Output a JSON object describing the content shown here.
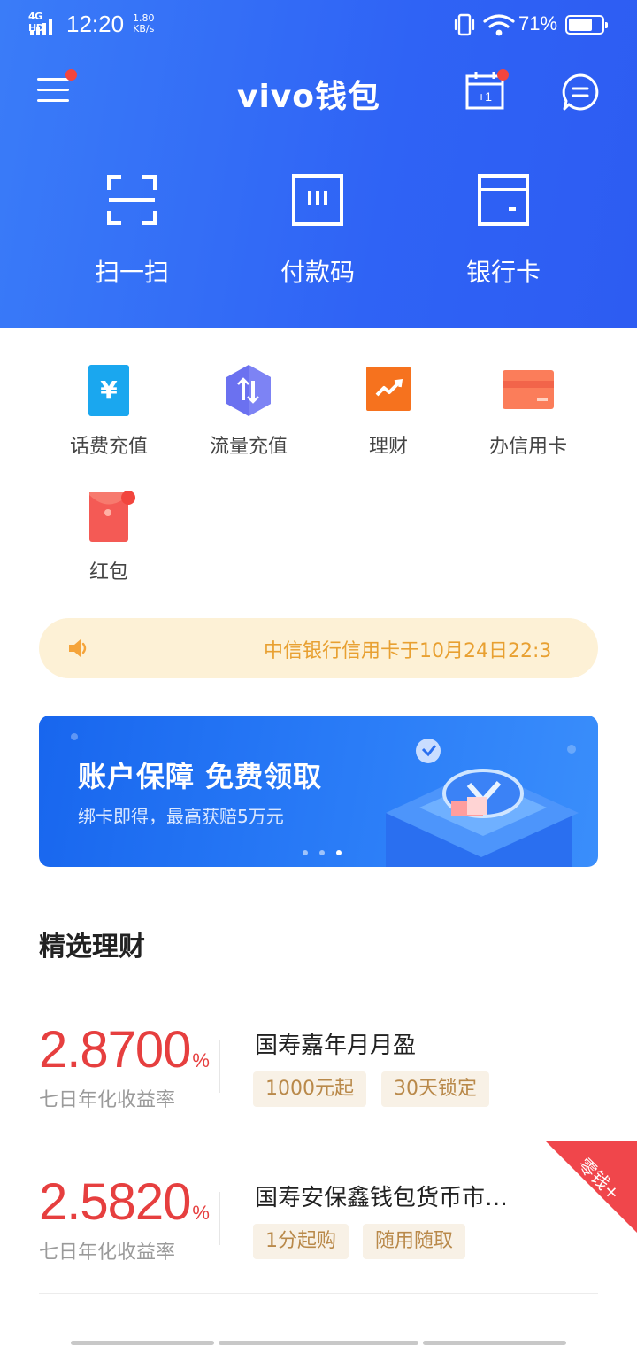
{
  "status_bar": {
    "network": "4G HD",
    "time": "12:20",
    "speed_value": "1.80",
    "speed_unit": "KB/s",
    "battery": "71%",
    "battery_level": 0.71
  },
  "header": {
    "title": "vivo钱包",
    "calendar_badge": "+1",
    "background_color": "#2f63f5"
  },
  "main_actions": [
    {
      "label": "扫一扫",
      "icon": "scan-icon"
    },
    {
      "label": "付款码",
      "icon": "payment-code-icon"
    },
    {
      "label": "银行卡",
      "icon": "bank-card-icon"
    }
  ],
  "services": [
    {
      "label": "话费充值",
      "icon": "phone-recharge-icon",
      "color": "#1aa7ef"
    },
    {
      "label": "流量充值",
      "icon": "data-recharge-icon",
      "color": "#6b71f0"
    },
    {
      "label": "理财",
      "icon": "finance-icon",
      "color": "#f6721e"
    },
    {
      "label": "办信用卡",
      "icon": "credit-card-icon",
      "color": "#fb7d5a"
    },
    {
      "label": "红包",
      "icon": "red-packet-icon",
      "color": "#f45a55"
    }
  ],
  "notice": {
    "text": "中信银行信用卡于10月24日22:3",
    "text_color": "#e8a031"
  },
  "banner": {
    "headline": "账户保障  免费领取",
    "subtext": "绑卡即得，最高获赔5万元",
    "slide_count": 3,
    "active_slide": 3
  },
  "section": {
    "title": "精选理财"
  },
  "products": [
    {
      "rate": "2.8700",
      "rate_unit": "%",
      "rate_label": "七日年化收益率",
      "name": "国寿嘉年月月盈",
      "tags": [
        "1000元起",
        "30天锁定"
      ]
    },
    {
      "rate": "2.5820",
      "rate_unit": "%",
      "rate_label": "七日年化收益率",
      "name": "国寿安保鑫钱包货币市…",
      "tags": [
        "1分起购",
        "随用随取"
      ],
      "corner_label": "零钱+"
    }
  ]
}
